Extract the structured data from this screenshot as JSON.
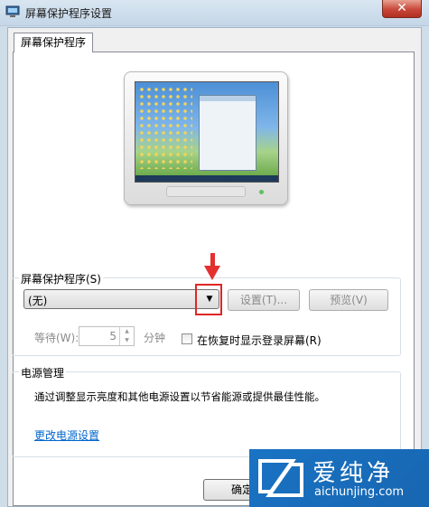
{
  "window": {
    "title": "屏幕保护程序设置",
    "close_glyph": "✕"
  },
  "tab": {
    "label": "屏幕保护程序"
  },
  "screensaver": {
    "group_label": "屏幕保护程序(S)",
    "selected": "(无)",
    "dropdown_glyph": "▼",
    "settings_button": "设置(T)...",
    "preview_button": "预览(V)",
    "wait_label": "等待(W):",
    "wait_value": "5",
    "wait_unit": "分钟",
    "resume_label": "在恢复时显示登录屏幕(R)",
    "resume_checked": false
  },
  "power": {
    "group_label": "电源管理",
    "description": "通过调整显示亮度和其他电源设置以节省能源或提供最佳性能。",
    "link": "更改电源设置"
  },
  "footer": {
    "ok_button": "确定"
  },
  "watermark": {
    "main": "爱纯净",
    "sub": "aichunjing.com"
  },
  "colors": {
    "annotation": "#e02626",
    "link": "#0066cc",
    "watermark_bg": "#1a73c4"
  },
  "icons": [
    "screensaver-app-icon",
    "close-icon",
    "monitor-preview",
    "dropdown-arrow-icon",
    "spin-up-icon",
    "spin-down-icon"
  ]
}
